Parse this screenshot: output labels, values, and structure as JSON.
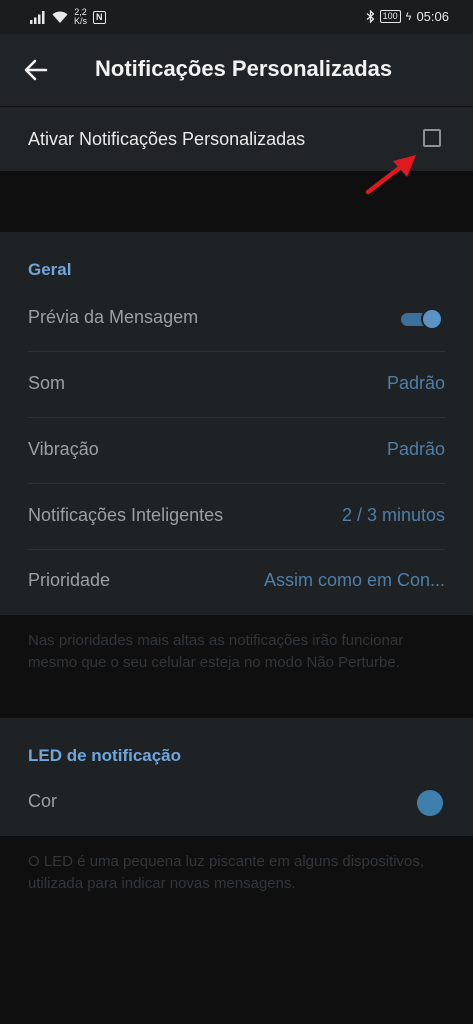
{
  "status_bar": {
    "speed_value": "2,2",
    "speed_unit": "K/s",
    "nfc": "N",
    "battery": "100",
    "time": "05:06"
  },
  "app_bar": {
    "title": "Notificações Personalizadas"
  },
  "enable_row": {
    "label": "Ativar Notificações Personalizadas",
    "checked": false
  },
  "general": {
    "title": "Geral",
    "rows": [
      {
        "label": "Prévia da Mensagem",
        "toggle": true
      },
      {
        "label": "Som",
        "value": "Padrão"
      },
      {
        "label": "Vibração",
        "value": "Padrão"
      },
      {
        "label": "Notificações Inteligentes",
        "value": "2 / 3 minutos"
      },
      {
        "label": "Prioridade",
        "value": "Assim como em Con..."
      }
    ],
    "note": "Nas prioridades mais altas as notificações irão funcionar mesmo que o seu celular esteja no modo Não Perturbe."
  },
  "led": {
    "title": "LED de notificação",
    "color_label": "Cor",
    "color": "#3f7fae",
    "note": "O LED é uma pequena luz piscante em alguns dispositivos, utilizada para indicar novas mensagens."
  },
  "colors": {
    "accent": "#6fa6dc",
    "annotation_arrow": "#e0191f"
  }
}
